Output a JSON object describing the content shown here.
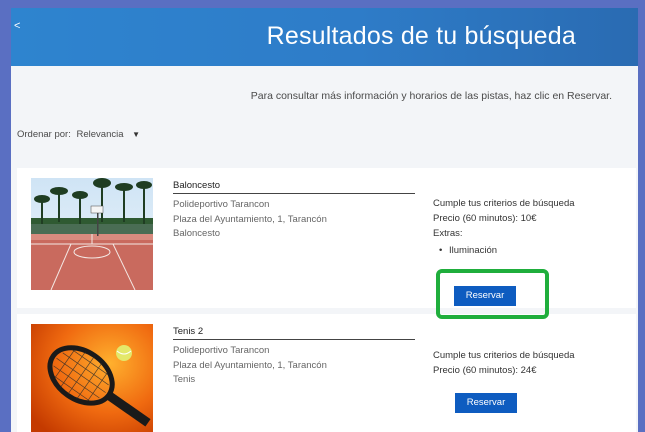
{
  "header": {
    "back_label": "<",
    "title": "Resultados de tu búsqueda"
  },
  "info_text": "Para consultar más información y horarios de las pistas, haz clic en Reservar.",
  "sort": {
    "label": "Ordenar por:",
    "value": "Relevancia",
    "caret": "▼"
  },
  "results": [
    {
      "title": "Baloncesto",
      "venue": "Polideportivo Tarancon",
      "address": "Plaza del Ayuntamiento, 1, Tarancón",
      "sport": "Baloncesto",
      "criteria": "Cumple tus criterios de búsqueda",
      "price": "Precio (60 minutos): 10€",
      "extras_label": "Extras:",
      "extras": [
        "Iluminación"
      ],
      "button_label": "Reservar"
    },
    {
      "title": "Tenis 2",
      "venue": "Polideportivo Tarancon",
      "address": "Plaza del Ayuntamiento, 1, Tarancón",
      "sport": "Tenis",
      "criteria": "Cumple tus criterios de búsqueda",
      "price": "Precio (60 minutos): 24€",
      "button_label": "Reservar"
    }
  ],
  "colors": {
    "header": "#2e7cc8",
    "button": "#0e5cc0",
    "highlight": "#1fae3c",
    "outer_background": "#5a6fc2"
  }
}
